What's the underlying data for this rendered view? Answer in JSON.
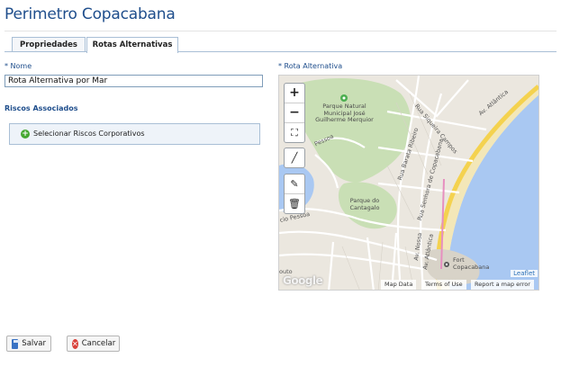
{
  "page": {
    "title": "Perimetro Copacabana"
  },
  "tabs": [
    {
      "label": "Propriedades",
      "active": false
    },
    {
      "label": "Rotas Alternativas",
      "active": true
    }
  ],
  "form": {
    "name_label": "* Nome",
    "name_value": "Rota Alternativa por Mar",
    "route_label": "* Rota Alternativa",
    "risks_label": "Riscos Associados",
    "select_risks_label": "Selecionar Riscos Corporativos"
  },
  "map": {
    "controls": {
      "zoom_in": "+",
      "zoom_out": "−",
      "fit": "⛶",
      "draw_line": "╱",
      "edit": "✎",
      "delete": "🗑"
    },
    "labels": {
      "park1": "Parque Natural Municipal José Guilherme Merquior",
      "park2": "Parque do Cantagalo",
      "fort": "Fort Copacabana",
      "street1": "Rua Siqueira Campos",
      "street2": "Av. Atlântica",
      "street3": "Rua Barata Ribeiro",
      "street4": "Rua Senhora de Copacabana",
      "street5": "Av. Nossa",
      "street6": "Av. Atlântica",
      "street7": "cio Pessoa",
      "street8": "Pessoa",
      "street9": "outo"
    },
    "google": "Google",
    "attribution": {
      "map_data": "Map Data",
      "terms": "Terms of Use",
      "report": "Report a map error",
      "leaflet": "Leaflet"
    },
    "colors": {
      "water": "#a9c8f2",
      "park": "#c9dfb5",
      "land": "#ebe7df",
      "road_main": "#f4d24f",
      "route": "#e78fc0"
    }
  },
  "footer": {
    "save_label": "Salvar",
    "cancel_label": "Cancelar"
  }
}
